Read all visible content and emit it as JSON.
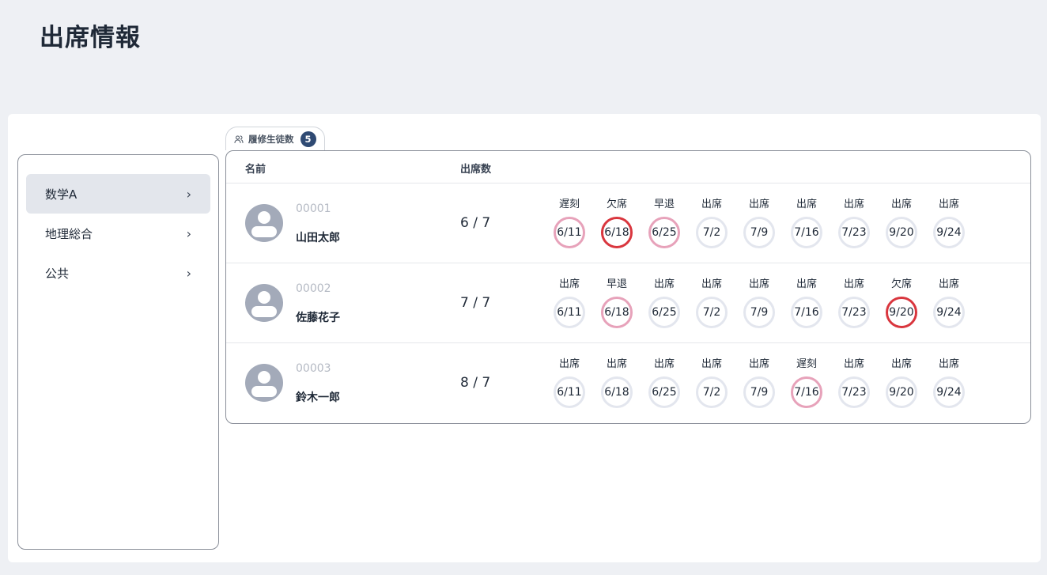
{
  "page": {
    "title": "出席情報"
  },
  "sidebar": {
    "items": [
      {
        "label": "数学A",
        "active": true
      },
      {
        "label": "地理総合",
        "active": false
      },
      {
        "label": "公共",
        "active": false
      }
    ]
  },
  "enrollment": {
    "label": "履修生徒数",
    "count": "5"
  },
  "table": {
    "headers": {
      "name": "名前",
      "attendance": "出席数"
    },
    "rows": [
      {
        "id": "00001",
        "name": "山田太郎",
        "attendance": "6 / 7",
        "sessions": [
          {
            "status": "遅刻",
            "date": "6/11",
            "type": "late"
          },
          {
            "status": "欠席",
            "date": "6/18",
            "type": "absent"
          },
          {
            "status": "早退",
            "date": "6/25",
            "type": "early"
          },
          {
            "status": "出席",
            "date": "7/2",
            "type": "present"
          },
          {
            "status": "出席",
            "date": "7/9",
            "type": "present"
          },
          {
            "status": "出席",
            "date": "7/16",
            "type": "present"
          },
          {
            "status": "出席",
            "date": "7/23",
            "type": "present"
          },
          {
            "status": "出席",
            "date": "9/20",
            "type": "present"
          },
          {
            "status": "出席",
            "date": "9/24",
            "type": "present"
          }
        ]
      },
      {
        "id": "00002",
        "name": "佐藤花子",
        "attendance": "7 / 7",
        "sessions": [
          {
            "status": "出席",
            "date": "6/11",
            "type": "present"
          },
          {
            "status": "早退",
            "date": "6/18",
            "type": "early"
          },
          {
            "status": "出席",
            "date": "6/25",
            "type": "present"
          },
          {
            "status": "出席",
            "date": "7/2",
            "type": "present"
          },
          {
            "status": "出席",
            "date": "7/9",
            "type": "present"
          },
          {
            "status": "出席",
            "date": "7/16",
            "type": "present"
          },
          {
            "status": "出席",
            "date": "7/23",
            "type": "present"
          },
          {
            "status": "欠席",
            "date": "9/20",
            "type": "absent"
          },
          {
            "status": "出席",
            "date": "9/24",
            "type": "present"
          }
        ]
      },
      {
        "id": "00003",
        "name": "鈴木一郎",
        "attendance": "8 / 7",
        "sessions": [
          {
            "status": "出席",
            "date": "6/11",
            "type": "present"
          },
          {
            "status": "出席",
            "date": "6/18",
            "type": "present"
          },
          {
            "status": "出席",
            "date": "6/25",
            "type": "present"
          },
          {
            "status": "出席",
            "date": "7/2",
            "type": "present"
          },
          {
            "status": "出席",
            "date": "7/9",
            "type": "present"
          },
          {
            "status": "遅刻",
            "date": "7/16",
            "type": "late"
          },
          {
            "status": "出席",
            "date": "7/23",
            "type": "present"
          },
          {
            "status": "出席",
            "date": "9/20",
            "type": "present"
          },
          {
            "status": "出席",
            "date": "9/24",
            "type": "present"
          }
        ]
      }
    ]
  },
  "colors": {
    "late_early_ring": "#e7a2ba",
    "absent_ring": "#d9363e",
    "present_ring": "#e3e6ee",
    "badge": "#2f4a73"
  }
}
